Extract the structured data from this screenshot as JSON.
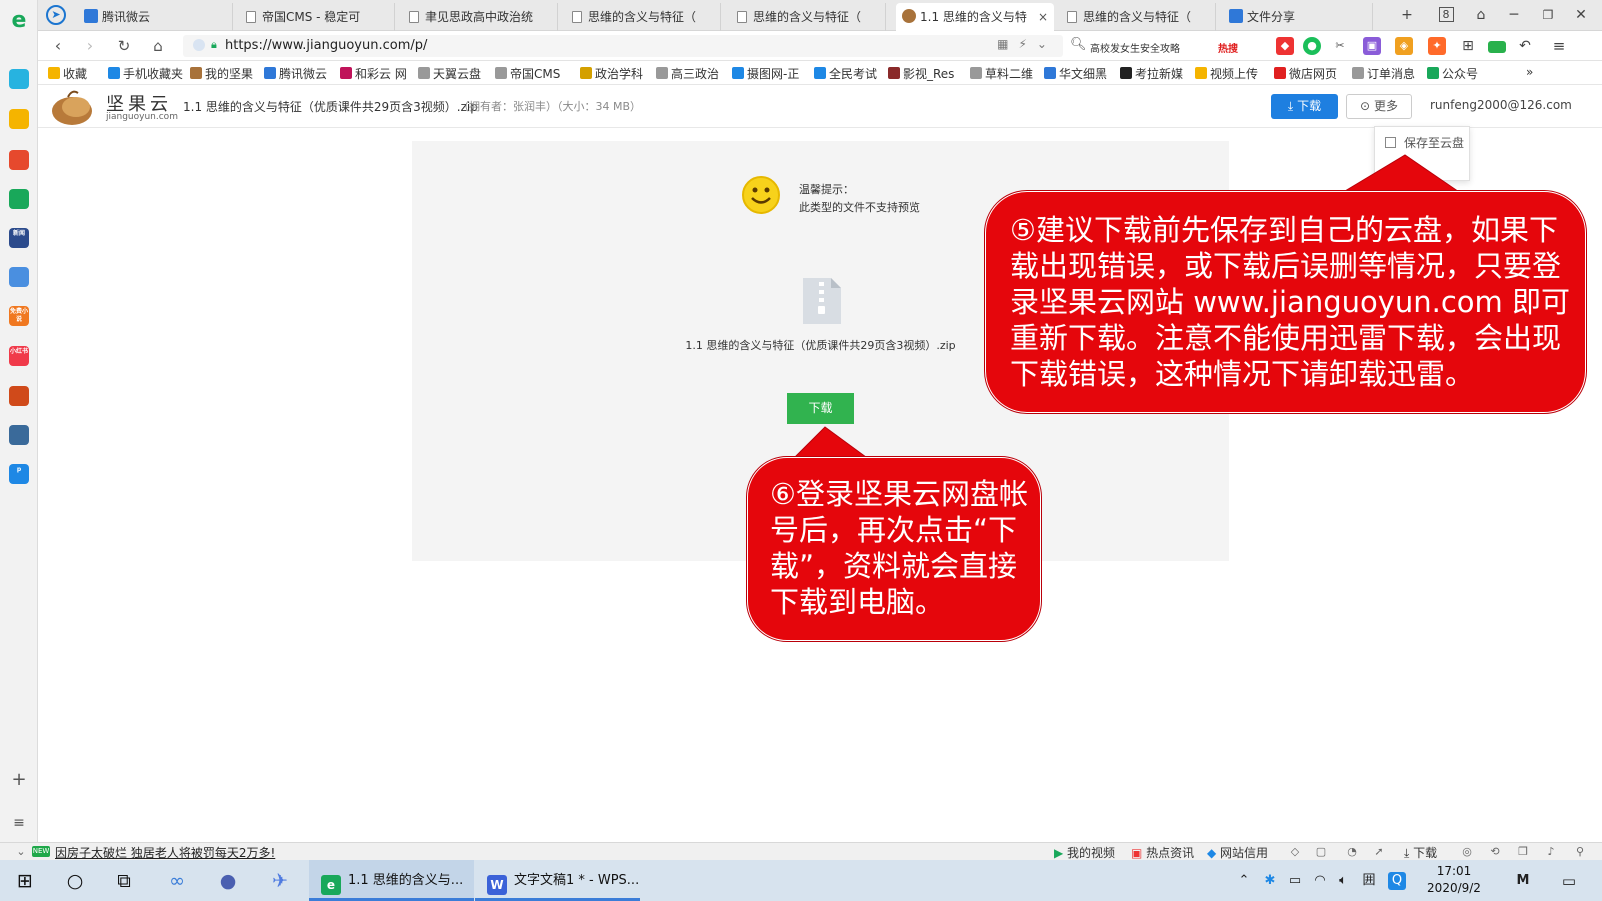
{
  "sidebar": {
    "apps": [
      {
        "icon": "plus-circle-icon",
        "color": "#27b3e0"
      },
      {
        "icon": "star-icon",
        "color": "#f5b400"
      },
      {
        "icon": "weibo-icon",
        "color": "#e6492d"
      },
      {
        "icon": "mail-icon",
        "color": "#19a85a"
      },
      {
        "icon": "news-icon",
        "color": "#2c4b8c",
        "text": "新闻"
      },
      {
        "icon": "doc-icon",
        "color": "#4a8fe0"
      },
      {
        "icon": "novel-icon",
        "color": "#f07820",
        "text": "免费小说"
      },
      {
        "icon": "shop-icon",
        "color": "#f03a4a",
        "text": "小红书"
      },
      {
        "icon": "game-icon",
        "color": "#d04a1a"
      },
      {
        "icon": "game2-icon",
        "color": "#3a6a9a"
      },
      {
        "icon": "pay-icon",
        "color": "#1e88e5",
        "text": "p"
      }
    ]
  },
  "tabs": [
    {
      "label": "腾讯微云",
      "fav": "blue"
    },
    {
      "label": "帝国CMS - 稳定可",
      "fav": "page"
    },
    {
      "label": "聿见思政高中政治统",
      "fav": "page"
    },
    {
      "label": "思维的含义与特征（",
      "fav": "page"
    },
    {
      "label": "思维的含义与特征（",
      "fav": "page"
    },
    {
      "label": "1.1 思维的含义与特",
      "fav": "nut",
      "active": true,
      "close": "×"
    },
    {
      "label": "思维的含义与特征（",
      "fav": "page"
    },
    {
      "label": "文件分享",
      "fav": "blue"
    }
  ],
  "tabstrip": {
    "new_tab": "+",
    "tab_count": "8"
  },
  "toolbar": {
    "url": "https://www.jianguoyun.com/p/",
    "search_text": "高校发女生安全攻略",
    "search_hot": "热搜"
  },
  "bookmarks": [
    {
      "label": "收藏",
      "color": "#f5b400"
    },
    {
      "label": "手机收藏夹",
      "color": "#1e88e5"
    },
    {
      "label": "我的坚果",
      "color": "#a8723a"
    },
    {
      "label": "腾讯微云",
      "color": "#2f78d8"
    },
    {
      "label": "和彩云 网",
      "color": "#c0135a"
    },
    {
      "label": "天翼云盘",
      "color": "#999999"
    },
    {
      "label": "帝国CMS",
      "color": "#999999"
    },
    {
      "label": "政治学科",
      "color": "#d4a000"
    },
    {
      "label": "高三政治",
      "color": "#999999"
    },
    {
      "label": "摄图网-正",
      "color": "#1e88e5"
    },
    {
      "label": "全民考试",
      "color": "#1e88e5"
    },
    {
      "label": "影视_Res",
      "color": "#8a2a2a"
    },
    {
      "label": "草料二维",
      "color": "#999999"
    },
    {
      "label": "华文细黑",
      "color": "#2f78d8"
    },
    {
      "label": "考拉新媒",
      "color": "#222222"
    },
    {
      "label": "视频上传",
      "color": "#f5b400"
    },
    {
      "label": "微店网页",
      "color": "#e02020"
    },
    {
      "label": "订单消息",
      "color": "#999999"
    },
    {
      "label": "公众号",
      "color": "#19a85a"
    }
  ],
  "bookmarks_more": "»",
  "page": {
    "logo_name": "坚果云",
    "logo_domain": "jianguoyun.com",
    "file_title": "1.1 思维的含义与特征（优质课件共29页含3视频）.zip",
    "file_meta": "（拥有者：张润丰）（大小：34 MB）",
    "download_label": "下载",
    "more_label": "更多",
    "user_email": "runfeng2000@126.com"
  },
  "dropdown": {
    "save_label": "保存至云盘"
  },
  "preview": {
    "tip_title": "温馨提示：",
    "tip_body": "此类型的文件不支持预览",
    "file_name": "1.1 思维的含义与特征（优质课件共29页含3视频）.zip",
    "download_label": "下载"
  },
  "callouts": {
    "c5": "⑤建议下载前先保存到自己的云盘，如果下载出现错误，或下载后误删等情况，只要登录坚果云网站 www.jianguoyun.com 即可重新下载。注意不能使用迅雷下载，会出现下载错误，这种情况下请卸载迅雷。",
    "c6": "⑥登录坚果云网盘帐号后，再次点击“下载”，资料就会直接下载到电脑。",
    "fill": "#e5060c"
  },
  "statusbar": {
    "news_badge": "NEW",
    "news_text": "因房子太破烂 独居老人将被罚每天2万多!",
    "items": [
      "我的视频",
      "热点资讯",
      "网站信用"
    ],
    "download_label": "下载"
  },
  "taskbar": {
    "apps": [
      {
        "label": "1.1 思维的含义与...",
        "color": "#19a85a",
        "glyph": "e",
        "active": true
      },
      {
        "label": "文字文稿1 * - WPS...",
        "color": "#3b62d8",
        "glyph": "W",
        "active": false
      }
    ],
    "time": "17:01",
    "date": "2020/9/2"
  }
}
